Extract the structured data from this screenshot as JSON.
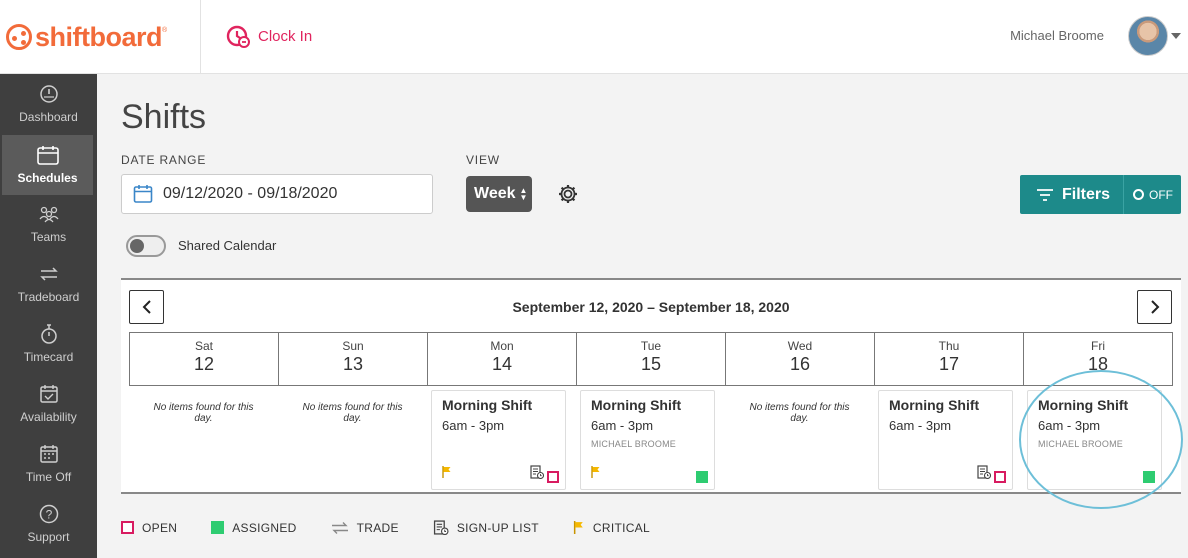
{
  "brand": {
    "name": "shiftboard",
    "accent": "#f26b3a"
  },
  "header": {
    "clock_in_label": "Clock In",
    "user_name": "Michael Broome"
  },
  "sidebar": {
    "items": [
      {
        "label": "Dashboard",
        "icon": "dashboard-icon"
      },
      {
        "label": "Schedules",
        "icon": "calendar-icon",
        "active": true
      },
      {
        "label": "Teams",
        "icon": "teams-icon"
      },
      {
        "label": "Tradeboard",
        "icon": "trade-icon"
      },
      {
        "label": "Timecard",
        "icon": "stopwatch-icon"
      },
      {
        "label": "Availability",
        "icon": "availability-icon"
      },
      {
        "label": "Time Off",
        "icon": "time-off-icon"
      },
      {
        "label": "Support",
        "icon": "help-icon"
      }
    ]
  },
  "main": {
    "title": "Shifts",
    "date_range_label": "DATE RANGE",
    "date_range_value": "09/12/2020 - 09/18/2020",
    "view_label": "VIEW",
    "view_value": "Week",
    "filters_label": "Filters",
    "filters_state": "OFF",
    "shared_calendar_label": "Shared Calendar",
    "shared_calendar_on": false
  },
  "calendar": {
    "range_title": "September 12, 2020 – September 18, 2020",
    "days": [
      {
        "dow": "Sat",
        "num": "12",
        "empty_text": "No items found for this day."
      },
      {
        "dow": "Sun",
        "num": "13",
        "empty_text": "No items found for this day."
      },
      {
        "dow": "Mon",
        "num": "14"
      },
      {
        "dow": "Tue",
        "num": "15"
      },
      {
        "dow": "Wed",
        "num": "16",
        "empty_text": "No items found for this day."
      },
      {
        "dow": "Thu",
        "num": "17"
      },
      {
        "dow": "Fri",
        "num": "18"
      }
    ],
    "shifts": {
      "mon": {
        "name": "Morning Shift",
        "time": "6am - 3pm",
        "person": "",
        "status": "open",
        "critical": true,
        "signup": true
      },
      "tue": {
        "name": "Morning Shift",
        "time": "6am - 3pm",
        "person": "MICHAEL BROOME",
        "status": "assigned",
        "critical": true
      },
      "thu": {
        "name": "Morning Shift",
        "time": "6am - 3pm",
        "person": "",
        "status": "open",
        "signup": true
      },
      "fri": {
        "name": "Morning Shift",
        "time": "6am - 3pm",
        "person": "MICHAEL BROOME",
        "status": "assigned"
      }
    },
    "colors": {
      "open": "#d81b60",
      "assigned": "#2ecc71",
      "critical": "#f5b800",
      "filters": "#1d8a8a"
    }
  },
  "legend": {
    "open": "OPEN",
    "assigned": "ASSIGNED",
    "trade": "TRADE",
    "signup": "SIGN-UP LIST",
    "critical": "CRITICAL"
  }
}
